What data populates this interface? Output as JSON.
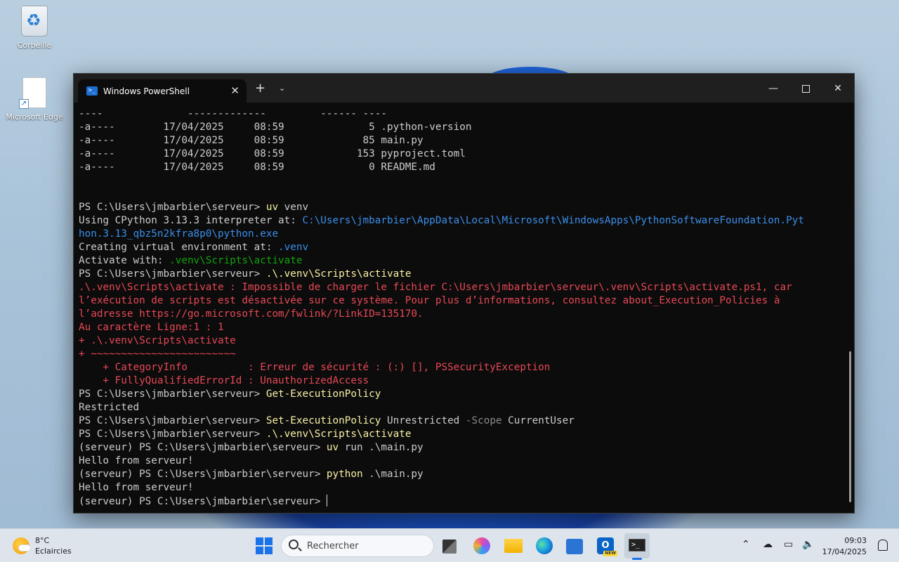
{
  "desktop": {
    "icons": [
      {
        "label": "Corbeille",
        "icon": "recycle-bin-icon"
      },
      {
        "label": "Microsoft Edge",
        "icon": "shortcut-file-icon"
      }
    ]
  },
  "window": {
    "tab_title": "Windows PowerShell",
    "tab_icon": "powershell-icon",
    "buttons": {
      "minimize": "—",
      "close": "✕"
    }
  },
  "console": {
    "lines": [
      [
        {
          "t": "----              -------------         ------ ----"
        }
      ],
      [
        {
          "t": "-a----        17/04/2025     08:59              5 .python-version"
        }
      ],
      [
        {
          "t": "-a----        17/04/2025     08:59             85 main.py"
        }
      ],
      [
        {
          "t": "-a----        17/04/2025     08:59            153 pyproject.toml"
        }
      ],
      [
        {
          "t": "-a----        17/04/2025     08:59              0 README.md"
        }
      ],
      [
        {
          "t": ""
        }
      ],
      [
        {
          "t": ""
        }
      ],
      [
        {
          "t": "PS C:\\Users\\jmbarbier\\serveur> "
        },
        {
          "t": "uv",
          "c": "yellow"
        },
        {
          "t": " venv"
        }
      ],
      [
        {
          "t": "Using CPython 3.13.3 interpreter at: "
        },
        {
          "t": "C:\\Users\\jmbarbier\\AppData\\Local\\Microsoft\\WindowsApps\\PythonSoftwareFoundation.Pyt",
          "c": "blue"
        }
      ],
      [
        {
          "t": "hon.3.13_qbz5n2kfra8p0\\python.exe",
          "c": "blue"
        }
      ],
      [
        {
          "t": "Creating virtual environment at: "
        },
        {
          "t": ".venv",
          "c": "blue"
        }
      ],
      [
        {
          "t": "Activate with: "
        },
        {
          "t": ".venv\\Scripts\\activate",
          "c": "green"
        }
      ],
      [
        {
          "t": "PS C:\\Users\\jmbarbier\\serveur> "
        },
        {
          "t": ".\\.venv\\Scripts\\activate",
          "c": "yellow"
        }
      ],
      [
        {
          "t": ".\\.venv\\Scripts\\activate : Impossible de charger le fichier C:\\Users\\jmbarbier\\serveur\\.venv\\Scripts\\activate.ps1, car",
          "c": "red"
        }
      ],
      [
        {
          "t": "l’exécution de scripts est désactivée sur ce système. Pour plus d’informations, consultez about_Execution_Policies à",
          "c": "red"
        }
      ],
      [
        {
          "t": "l’adresse https://go.microsoft.com/fwlink/?LinkID=135170.",
          "c": "red"
        }
      ],
      [
        {
          "t": "Au caractère Ligne:1 : 1",
          "c": "red"
        }
      ],
      [
        {
          "t": "+ .\\.venv\\Scripts\\activate",
          "c": "red"
        }
      ],
      [
        {
          "t": "+ ~~~~~~~~~~~~~~~~~~~~~~~~",
          "c": "red"
        }
      ],
      [
        {
          "t": "    + CategoryInfo          : Erreur de sécurité : (:) [], PSSecurityException",
          "c": "red"
        }
      ],
      [
        {
          "t": "    + FullyQualifiedErrorId : UnauthorizedAccess",
          "c": "red"
        }
      ],
      [
        {
          "t": "PS C:\\Users\\jmbarbier\\serveur> "
        },
        {
          "t": "Get-ExecutionPolicy",
          "c": "yellow"
        }
      ],
      [
        {
          "t": "Restricted"
        }
      ],
      [
        {
          "t": "PS C:\\Users\\jmbarbier\\serveur> "
        },
        {
          "t": "Set-ExecutionPolicy",
          "c": "yellow"
        },
        {
          "t": " Unrestricted "
        },
        {
          "t": "-Scope",
          "c": "gray"
        },
        {
          "t": " CurrentUser"
        }
      ],
      [
        {
          "t": "PS C:\\Users\\jmbarbier\\serveur> "
        },
        {
          "t": ".\\.venv\\Scripts\\activate",
          "c": "yellow"
        }
      ],
      [
        {
          "t": "(serveur) PS C:\\Users\\jmbarbier\\serveur> "
        },
        {
          "t": "uv",
          "c": "yellow"
        },
        {
          "t": " run .\\main.py"
        }
      ],
      [
        {
          "t": "Hello from serveur!"
        }
      ],
      [
        {
          "t": "(serveur) PS C:\\Users\\jmbarbier\\serveur> "
        },
        {
          "t": "python",
          "c": "yellow"
        },
        {
          "t": " .\\main.py"
        }
      ],
      [
        {
          "t": "Hello from serveur!"
        }
      ],
      [
        {
          "t": "(serveur) PS C:\\Users\\jmbarbier\\serveur> "
        }
      ]
    ]
  },
  "taskbar": {
    "weather_temp": "8°C",
    "weather_desc": "Eclaircies",
    "search_placeholder": "Rechercher",
    "time": "09:03",
    "date": "17/04/2025",
    "pinned": [
      "start-icon",
      "task-view-icon",
      "copilot-icon",
      "file-explorer-icon",
      "edge-icon",
      "store-icon",
      "outlook-icon",
      "terminal-icon"
    ],
    "outlook_badge": "NEW",
    "outlook_letter": "O"
  }
}
